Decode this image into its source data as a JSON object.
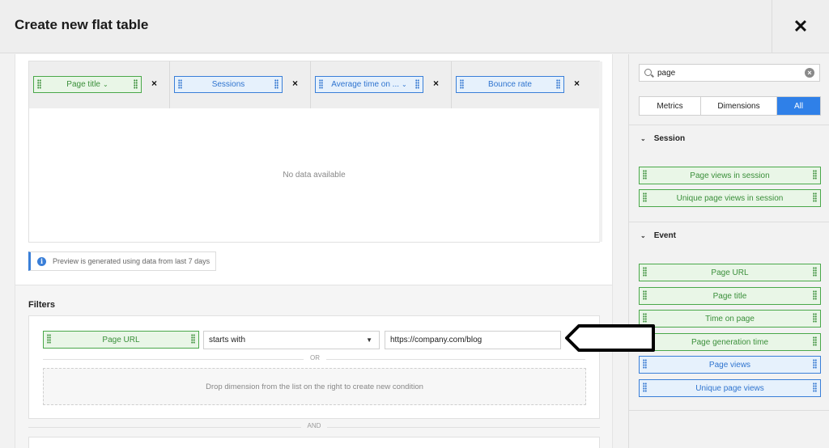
{
  "header": {
    "title": "Create new flat table",
    "close_icon": "close-icon"
  },
  "preview": {
    "columns": [
      {
        "label": "Page title",
        "type": "dimension",
        "has_dropdown": true
      },
      {
        "label": "Sessions",
        "type": "metric",
        "has_dropdown": false
      },
      {
        "label": "Average time on ...",
        "type": "metric",
        "has_dropdown": true
      },
      {
        "label": "Bounce rate",
        "type": "metric",
        "has_dropdown": false
      }
    ],
    "remove_symbol": "×",
    "empty_text": "No data available",
    "note": "Preview is generated using data from last 7 days"
  },
  "filters": {
    "title": "Filters",
    "condition": {
      "dimension": "Page URL",
      "operator": "starts with",
      "value": "https://company.com/blog"
    },
    "or_label": "OR",
    "drop_hint": "Drop dimension from the list on the right to create new condition",
    "and_label": "AND"
  },
  "sidebar": {
    "search_value": "page",
    "tabs": [
      {
        "label": "Metrics",
        "active": false
      },
      {
        "label": "Dimensions",
        "active": false
      },
      {
        "label": "All",
        "active": true
      }
    ],
    "groups": [
      {
        "title": "Session",
        "items": [
          {
            "label": "Page views in session",
            "type": "dimension"
          },
          {
            "label": "Unique page views in session",
            "type": "dimension"
          }
        ]
      },
      {
        "title": "Event",
        "items": [
          {
            "label": "Page URL",
            "type": "dimension"
          },
          {
            "label": "Page title",
            "type": "dimension"
          },
          {
            "label": "Time on page",
            "type": "dimension"
          },
          {
            "label": "Page generation time",
            "type": "dimension"
          },
          {
            "label": "Page views",
            "type": "metric"
          },
          {
            "label": "Unique page views",
            "type": "metric"
          }
        ]
      }
    ]
  },
  "colors": {
    "dimension": "#4aa84a",
    "metric": "#3a7fd8",
    "accent": "#2f80e8"
  }
}
